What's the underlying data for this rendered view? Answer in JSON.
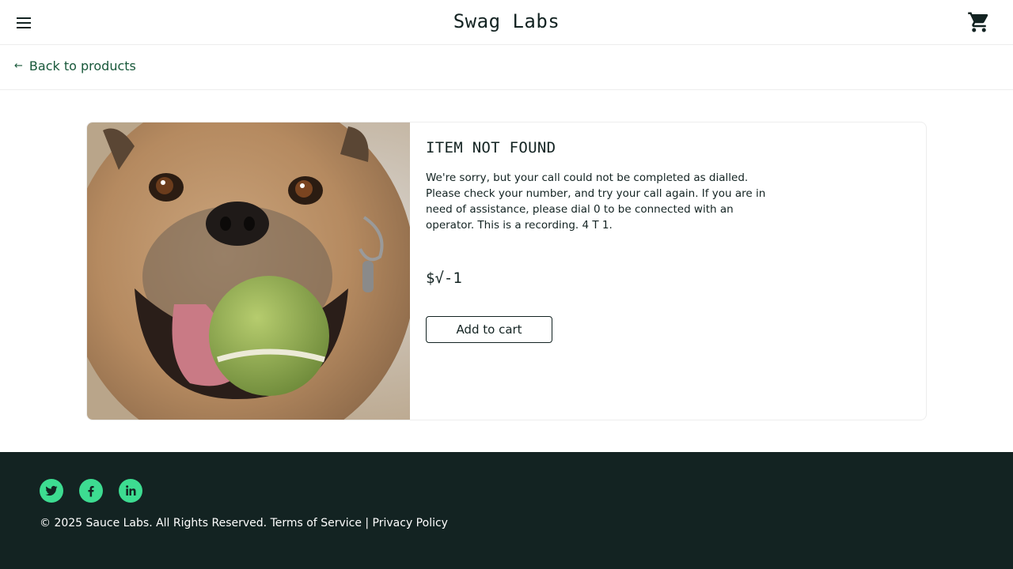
{
  "header": {
    "title": "Swag Labs",
    "menu_icon": "hamburger-menu-icon",
    "cart_icon": "shopping-cart-icon"
  },
  "subheader": {
    "back_arrow": "←",
    "back_label": "Back to products"
  },
  "product": {
    "image": "pug-with-tennis-ball",
    "name": "ITEM NOT FOUND",
    "description": "We're sorry, but your call could not be completed as dialled. Please check your number, and try your call again. If you are in need of assistance, please dial 0 to be connected with an operator. This is a recording. 4 T 1.",
    "price": "$√-1",
    "add_to_cart_label": "Add to cart"
  },
  "footer": {
    "social": [
      "twitter-icon",
      "facebook-icon",
      "linkedin-icon"
    ],
    "copyright": "© 2025 Sauce Labs. All Rights Reserved. Terms of Service | Privacy Policy"
  },
  "colors": {
    "accent": "#3ddc91",
    "footer_bg": "#132322",
    "link": "#18583a"
  }
}
